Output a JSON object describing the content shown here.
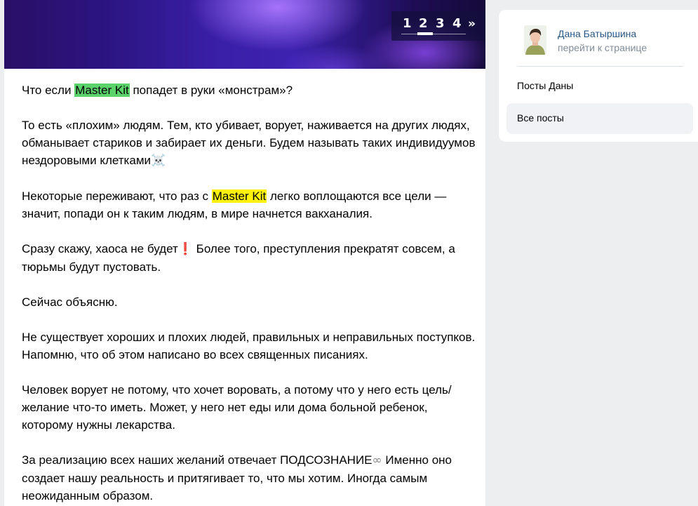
{
  "pager": {
    "pages": [
      "1",
      "2",
      "3",
      "4"
    ],
    "next": "»",
    "current": "2"
  },
  "post": {
    "paragraphs": [
      {
        "segments": [
          {
            "t": "Что если "
          },
          {
            "t": "Master Kit",
            "hl": "green"
          },
          {
            "t": " попадет в руки «монстрам»?"
          }
        ]
      },
      {
        "segments": [
          {
            "t": "То есть «плохим» людям. Тем, кто убивает, ворует, наживается на других людях, обманывает стариков и забирает их деньги. Будем называть таких индивидуумов нездоровыми клетками"
          },
          {
            "t": "☠️",
            "cls": "emoji"
          }
        ]
      },
      {
        "segments": [
          {
            "t": "Некоторые переживают, что раз с "
          },
          {
            "t": "Master Kit",
            "hl": "yellow"
          },
          {
            "t": " легко воплощаются все цели — значит, попади он к таким людям, в мире начнется вакханалия."
          }
        ]
      },
      {
        "segments": [
          {
            "t": "Сразу скажу, хаоса не будет"
          },
          {
            "t": "❗",
            "cls": "ex"
          },
          {
            "t": " Более того, преступления прекратят совсем, а тюрьмы будут пустовать."
          }
        ]
      },
      {
        "segments": [
          {
            "t": "Сейчас объясню."
          }
        ]
      },
      {
        "segments": [
          {
            "t": "Не существует хороших и плохих людей, правильных и неправильных поступков. Напомню, что об этом написано во всех священных писаниях."
          }
        ]
      },
      {
        "segments": [
          {
            "t": "Человек ворует не потому, что хочет воровать, а потому что у него есть цель/желание что-то иметь. Может, у него нет еды или дома больной ребенок, которому нужны лекарства."
          }
        ]
      },
      {
        "segments": [
          {
            "t": "За реализацию всех наших желаний отвечает ПОДСОЗНАНИЕ"
          },
          {
            "t": "∞",
            "cls": "inf"
          },
          {
            "t": " Именно оно создает нашу реальность и притягивает то, что мы хотим. Иногда самым неожиданным образом."
          }
        ]
      }
    ]
  },
  "sidebar": {
    "author_name": "Дана Батыршина",
    "goto_link": "перейти к странице",
    "menu": [
      "Посты Даны",
      "Все посты"
    ],
    "selected_index": 1
  }
}
